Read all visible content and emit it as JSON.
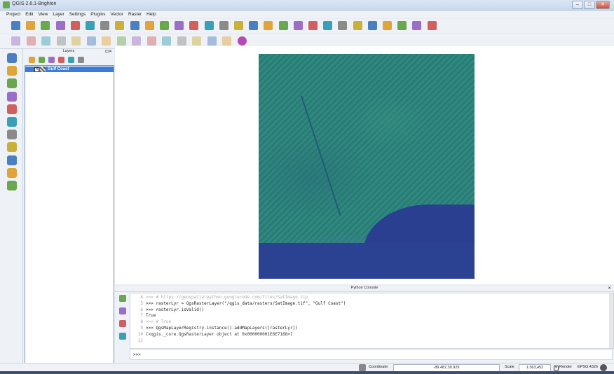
{
  "window": {
    "title": "QGIS 2.6.1-Brighton",
    "min": "–",
    "max": "□",
    "close": "✕"
  },
  "menu": [
    "Project",
    "Edit",
    "View",
    "Layer",
    "Settings",
    "Plugins",
    "Vector",
    "Raster",
    "Help"
  ],
  "toolbar_icons": {
    "top": [
      "new-project-icon",
      "open-project-icon",
      "save-project-icon",
      "save-as-icon",
      "new-print-composer-icon",
      "composer-manager-icon",
      "touch-zoom-icon",
      "pan-map-icon",
      "pan-to-selection-icon",
      "zoom-in-icon",
      "zoom-out-icon",
      "zoom-to-native-icon",
      "zoom-full-icon",
      "zoom-to-selection-icon",
      "zoom-to-layer-icon",
      "zoom-last-icon",
      "zoom-next-icon",
      "refresh-icon",
      "identify-icon",
      "select-icon",
      "deselect-icon",
      "attribute-table-icon",
      "field-calculator-icon",
      "measure-icon",
      "map-tips-icon",
      "bookmark-icon",
      "annotation-icon",
      "label-icon",
      "help-icon"
    ],
    "second": [
      "current-edits-icon",
      "toggle-editing-icon",
      "save-edits-icon",
      "add-feature-icon",
      "move-feature-icon",
      "node-tool-icon",
      "delete-selected-icon",
      "cut-features-icon",
      "copy-features-icon",
      "paste-features-icon",
      "label-pin-icon",
      "label-show-hide-icon",
      "label-move-icon",
      "label-rotate-icon",
      "label-change-icon",
      "python-console-icon"
    ]
  },
  "left_toolbar_icons": [
    "add-vector-layer-icon",
    "add-raster-layer-icon",
    "add-postgis-layer-icon",
    "add-spatialite-layer-icon",
    "add-mssql-layer-icon",
    "add-oracle-layer-icon",
    "add-wms-layer-icon",
    "add-wcs-layer-icon",
    "add-wfs-layer-icon",
    "add-delimited-text-icon",
    "new-shapefile-icon"
  ],
  "layers_panel": {
    "title": "Layers",
    "controls": "⊡✕",
    "tools": [
      "open-layer-styling-icon",
      "add-group-icon",
      "filter-legend-icon",
      "expand-all-icon",
      "collapse-all-icon",
      "remove-layer-icon"
    ],
    "layers": [
      {
        "name": "Gulf Coast",
        "checked": "✕"
      }
    ]
  },
  "python_console": {
    "title": "Python Console",
    "close": "✕",
    "lines": [
      {
        "n": "4",
        "text": ">>> # https://geospatialpython.googlecode.com/files/SatImage.zip",
        "kind": "comment"
      },
      {
        "n": "5",
        "text": ">>> rasterLyr = QgsRasterLayer(\"/qgis_data/rasters/SatImage.tif\", \"Gulf Coast\")",
        "kind": "code"
      },
      {
        "n": "6",
        "text": ">>> rasterLyr.isValid()",
        "kind": "code"
      },
      {
        "n": "7",
        "text": "True",
        "kind": "result"
      },
      {
        "n": "8",
        "text": ">>> # True",
        "kind": "comment"
      },
      {
        "n": "9",
        "text": ">>> QgsMapLayerRegistry.instance().addMapLayers([rasterLyr])",
        "kind": "code"
      },
      {
        "n": "10",
        "text": "[<qgis._core.QgsRasterLayer object at 0x000000001E6E7168>]",
        "kind": "result"
      },
      {
        "n": "11",
        "text": "",
        "kind": "result"
      }
    ],
    "prompt": ">>>",
    "tools": [
      "clear-console-icon",
      "import-class-icon",
      "run-command-icon",
      "show-editor-icon"
    ]
  },
  "statusbar": {
    "coordinate_label": "Coordinate:",
    "coordinate_value": "-89.487,30.929",
    "scale_label": "Scale",
    "scale_value": "1:363,452",
    "render_label": "Render",
    "render_checked": "✕",
    "crs": "EPSG:4326"
  },
  "colors": {
    "selection": "#3a7cd8",
    "water": "#2b4192",
    "land": "#2d857b"
  }
}
